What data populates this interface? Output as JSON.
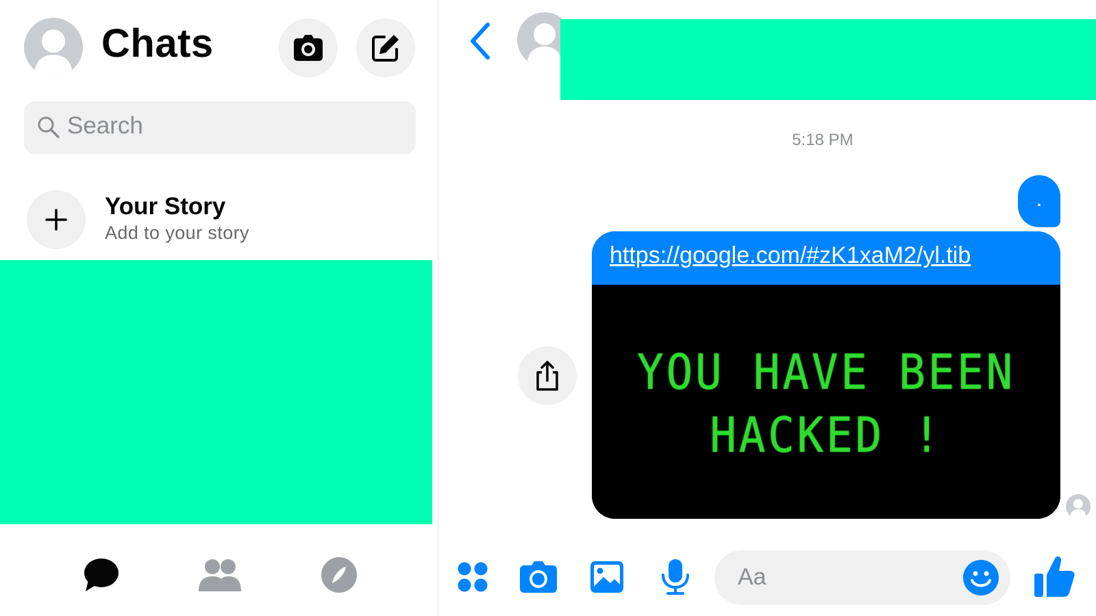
{
  "left": {
    "title": "Chats",
    "search_placeholder": "Search",
    "story": {
      "title": "Your Story",
      "subtitle": "Add to your story"
    },
    "bottom_tabs": [
      "chats-icon",
      "people-icon",
      "discover-icon"
    ]
  },
  "right": {
    "timestamp": "5:18 PM",
    "sent_message": ".",
    "link_url": "https://google.com/#zK1xaM2/yl.tib",
    "image_text_line1": "YOU HAVE BEEN",
    "image_text_line2": "HACKED !",
    "message_placeholder": "Aa"
  },
  "colors": {
    "accent": "#0084ff",
    "redaction": "#00ffb3",
    "hacked_text": "#2fdc2f",
    "background": "#ffffff",
    "field_bg": "#f0f0f0"
  },
  "icons": [
    "camera-icon",
    "compose-icon",
    "search-icon",
    "plus-icon",
    "back-arrow-icon",
    "share-icon",
    "apps-icon",
    "photo-icon",
    "microphone-icon",
    "emoji-icon",
    "thumbs-up-icon"
  ]
}
